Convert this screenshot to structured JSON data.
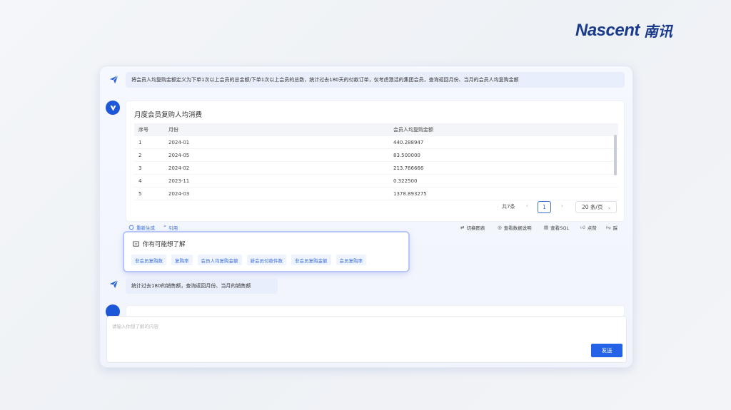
{
  "brand": {
    "name": "Nascent",
    "name_cn": "南讯"
  },
  "chat": {
    "q1": "将会员人均复购金额定义为下单1次以上会员的总金额/下单1次以上会员的总数，统计过去180天的付款订单，仅考虑激活的集团会员，查询返回月份、当月的会员人均复购金额",
    "answer": {
      "title": "月度会员复购人均消费",
      "columns": [
        "序号",
        "月份",
        "会员人均复购金额"
      ],
      "rows": [
        [
          "1",
          "2024-01",
          "440.288947"
        ],
        [
          "2",
          "2024-05",
          "83.500000"
        ],
        [
          "3",
          "2024-02",
          "213.766666"
        ],
        [
          "4",
          "2023-11",
          "0.322500"
        ],
        [
          "5",
          "2024-03",
          "1378.893275"
        ]
      ],
      "pagination": {
        "total": "共7条",
        "current": "1",
        "page_size": "20 条/页"
      }
    },
    "actions_left": {
      "regenerate": "重新生成",
      "quote": "引用"
    },
    "actions_right": {
      "switch_chart": "切换图表",
      "view_data_desc": "查看数据说明",
      "view_sql": "查看SQL",
      "like": "点赞",
      "dislike": "踩"
    },
    "suggestions": {
      "title": "你有可能想了解",
      "items": [
        "非会员复购数",
        "复购率",
        "会员人均复购金额",
        "新会员付款件数",
        "非会员复购金额",
        "会员复购率"
      ]
    },
    "q2": "统计过去180的销售额，查询返回月份、当月的销售额"
  },
  "input": {
    "placeholder": "请输入你想了解的内容",
    "value": "",
    "send_label": "发送"
  },
  "colors": {
    "accent": "#2463e8",
    "brand": "#1a3a8c",
    "chip_bg": "#eef3fd"
  }
}
